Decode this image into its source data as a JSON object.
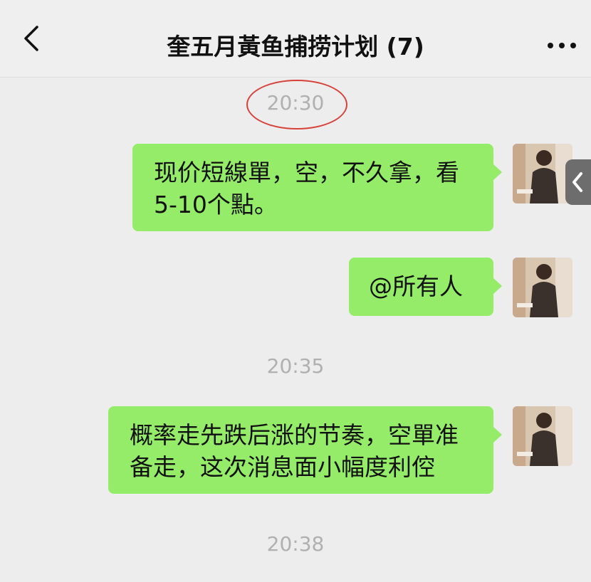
{
  "header": {
    "back_icon": "chevron-left-icon",
    "title": "奎五月黃鱼捕捞计划 (7)",
    "more_icon": "ellipsis-icon"
  },
  "timestamps": [
    "20:30",
    "20:35",
    "20:38"
  ],
  "messages": [
    {
      "lines": [
        "现价短線單，空，不久拿，看",
        "5-10个點。"
      ],
      "sender": "self"
    },
    {
      "lines": [
        "@所有人"
      ],
      "sender": "self"
    },
    {
      "lines": [
        "概率走先跌后涨的节奏，空單准",
        "备走，这次消息面小幅度利倥"
      ],
      "sender": "self"
    }
  ],
  "colors": {
    "bubble": "#95ec69",
    "background": "#ededed",
    "annotation_circle": "#d8413a"
  }
}
